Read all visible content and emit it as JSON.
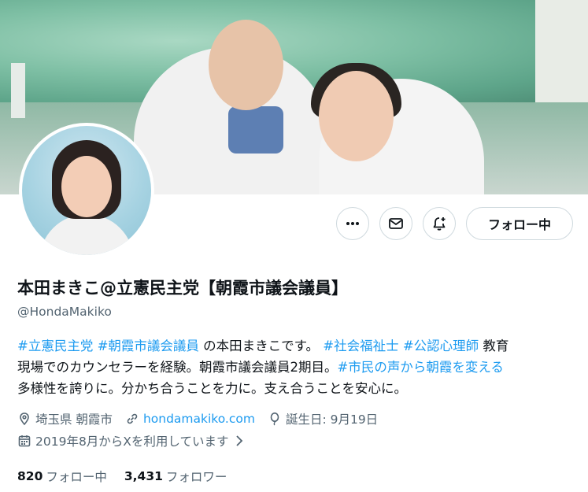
{
  "profile": {
    "display_name": "本田まきこ@立憲民主党【朝霞市議会議員】",
    "handle": "@HondaMakiko",
    "bio": {
      "line1": [
        {
          "text": "#立憲民主党",
          "tag": true
        },
        {
          "text": " ",
          "tag": false
        },
        {
          "text": "#朝霞市議会議員",
          "tag": true
        },
        {
          "text": " の本田まきこです。 ",
          "tag": false
        },
        {
          "text": "#社会福祉士",
          "tag": true
        },
        {
          "text": " ",
          "tag": false
        },
        {
          "text": "#公認心理師",
          "tag": true
        },
        {
          "text": " 教育",
          "tag": false
        }
      ],
      "line2": [
        {
          "text": "現場でのカウンセラーを経験。朝霞市議会議員2期目。",
          "tag": false
        },
        {
          "text": "#市民の声から朝霞を変える",
          "tag": true
        }
      ],
      "line3": [
        {
          "text": "多様性を誇りに。分かち合うことを力に。支え合うことを安心に。",
          "tag": false
        }
      ]
    },
    "location": "埼玉県 朝霞市",
    "website": "hondamakiko.com",
    "birthday": "誕生日: 9月19日",
    "joined": "2019年8月からXを利用しています",
    "following_count": "820",
    "following_label": "フォロー中",
    "followers_count": "3,431",
    "followers_label": "フォロワー"
  },
  "actions": {
    "more_icon": "more-icon",
    "message_icon": "mail-icon",
    "notify_icon": "bell-plus-icon",
    "follow_label": "フォロー中"
  },
  "colors": {
    "link": "#1d9bf0",
    "secondary_text": "#536471",
    "primary_text": "#0f1419",
    "border": "#cfd9de"
  }
}
